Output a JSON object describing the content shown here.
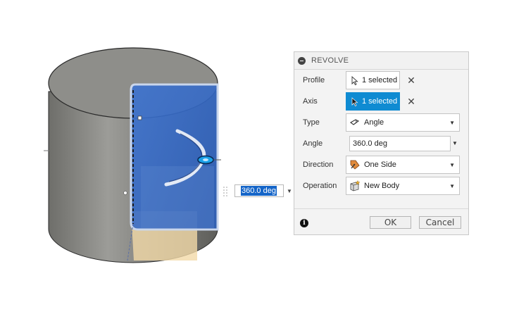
{
  "canvas": {
    "angle_input_value": "360.0 deg"
  },
  "dialog": {
    "title": "REVOLVE",
    "profile": {
      "label": "Profile",
      "value": "1 selected",
      "clear": "✕"
    },
    "axis": {
      "label": "Axis",
      "value": "1 selected",
      "clear": "✕"
    },
    "type": {
      "label": "Type",
      "value": "Angle"
    },
    "angle": {
      "label": "Angle",
      "value": "360.0 deg"
    },
    "direction": {
      "label": "Direction",
      "value": "One Side"
    },
    "operation": {
      "label": "Operation",
      "value": "New Body"
    },
    "ok_label": "OK",
    "cancel_label": "Cancel",
    "info_glyph": "i"
  },
  "colors": {
    "selection_blue": "#0f8bd2",
    "profile_face": "#2f68c8",
    "body_gray": "#8b8b87"
  }
}
